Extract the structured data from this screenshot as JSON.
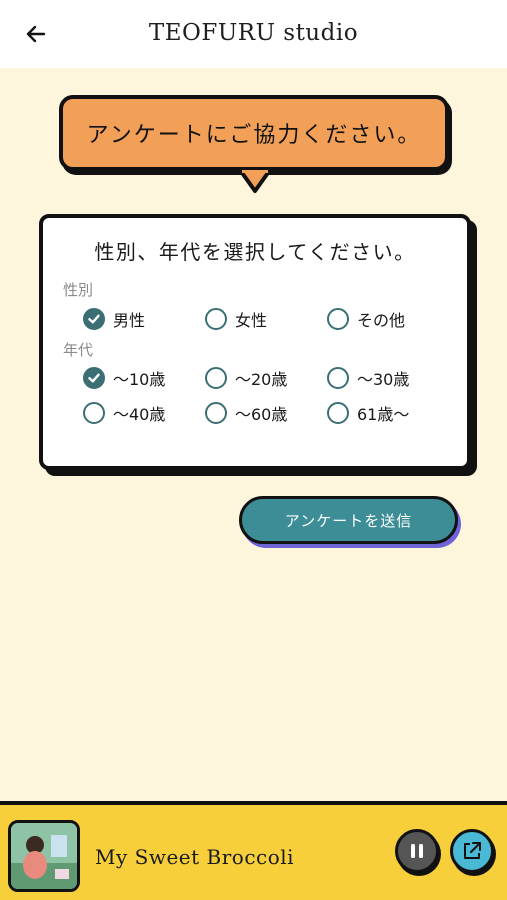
{
  "header": {
    "title": "TEOFURU studio",
    "back_icon": "arrow-left-icon"
  },
  "bubble": {
    "text": "アンケートにご協力ください。"
  },
  "survey": {
    "title": "性別、年代を選択してください。",
    "gender": {
      "label": "性別",
      "options": [
        {
          "label": "男性",
          "checked": true
        },
        {
          "label": "女性",
          "checked": false
        },
        {
          "label": "その他",
          "checked": false
        }
      ]
    },
    "age": {
      "label": "年代",
      "options": [
        {
          "label": "～10歳",
          "checked": true
        },
        {
          "label": "～20歳",
          "checked": false
        },
        {
          "label": "～30歳",
          "checked": false
        },
        {
          "label": "～40歳",
          "checked": false
        },
        {
          "label": "～60歳",
          "checked": false
        },
        {
          "label": "61歳～",
          "checked": false
        }
      ]
    }
  },
  "submit": {
    "label": "アンケートを送信"
  },
  "player": {
    "track_title": "My Sweet Broccoli",
    "pause_icon": "pause-icon",
    "share_icon": "external-link-icon"
  },
  "colors": {
    "background": "#fdf5dc",
    "bubble": "#f2a057",
    "accent": "#3d8d96",
    "radio": "#3c6f74",
    "player_bar": "#f7cf3a",
    "share_button": "#49b9d6"
  }
}
